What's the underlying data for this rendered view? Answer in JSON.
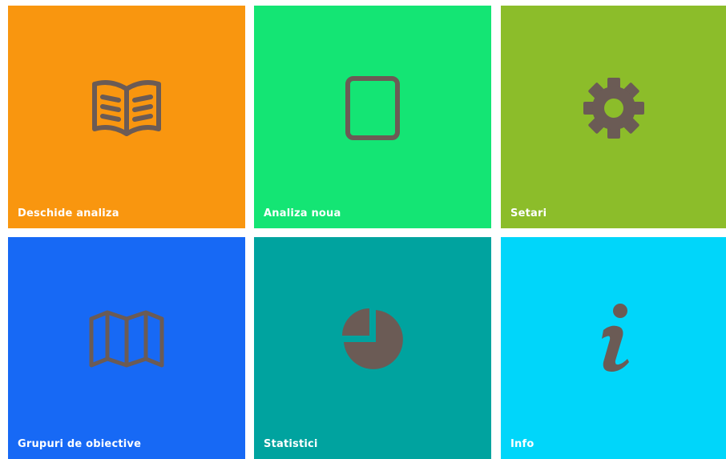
{
  "tiles": [
    {
      "label": "Deschide analiza",
      "icon": "open-book-icon",
      "color": "#F9960F"
    },
    {
      "label": "Analiza noua",
      "icon": "tablet-icon",
      "color": "#14E574"
    },
    {
      "label": "Setari",
      "icon": "gear-icon",
      "color": "#8CBD2A"
    },
    {
      "label": "Grupuri de obiective",
      "icon": "map-icon",
      "color": "#1769F5"
    },
    {
      "label": "Statistici",
      "icon": "pie-chart-icon",
      "color": "#00A39F"
    },
    {
      "label": "Info",
      "icon": "info-icon",
      "color": "#00D6FA"
    }
  ],
  "icon_color": "#6B5B55"
}
